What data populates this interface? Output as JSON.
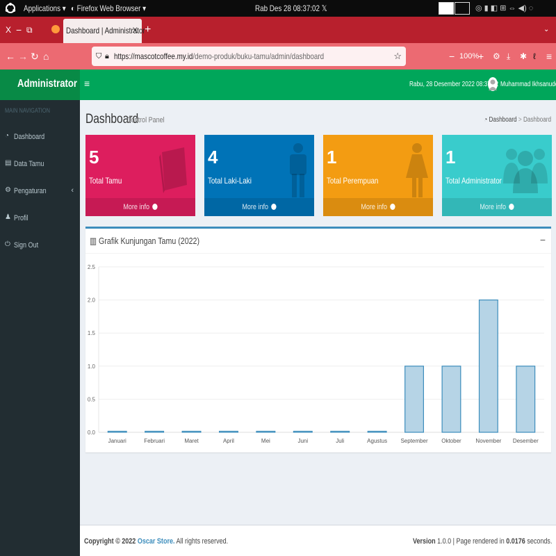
{
  "os_bar": {
    "applications": "Applications",
    "browser_name": "Firefox Web Browser",
    "clock": "Rab Des 28  08:37:02",
    "x_label": "𝕏"
  },
  "tabs": {
    "active_title": "Dashboard | Administrator",
    "close": "X",
    "new_tab": "+",
    "window_x": "X",
    "window_min": "−",
    "window_restore": "⧉"
  },
  "navbar": {
    "url_host": "https://mascotcoffee.my.id",
    "url_path": "/demo-produk/buku-tamu/admin/dashboard",
    "zoom": "100%",
    "zoom_minus": "−",
    "zoom_plus": "+"
  },
  "header": {
    "logo": "Administrator",
    "toggle": "≡",
    "datetime": "Rabu, 28 Desember 2022 08:37:02",
    "user_name": "Muhammad Ikhsanuddin"
  },
  "sidebar": {
    "heading": "MAIN NAVIGATION",
    "items": [
      {
        "label": "Dashboard",
        "icon": "dashboard-icon"
      },
      {
        "label": "Data Tamu",
        "icon": "book-icon"
      },
      {
        "label": "Pengaturan",
        "icon": "cogs-icon"
      },
      {
        "label": "Profil",
        "icon": "user-icon"
      },
      {
        "label": "Sign Out",
        "icon": "sign-out-icon"
      }
    ]
  },
  "page": {
    "title": "Dashboard",
    "subtitle": "Control Panel",
    "breadcrumb_home": "Dashboard",
    "breadcrumb_sep": ">",
    "breadcrumb_current": "Dashboard"
  },
  "stats": [
    {
      "value": "5",
      "label": "Total Tamu",
      "more": "More info",
      "color": "#dd1e5e",
      "icon": "book-icon"
    },
    {
      "value": "4",
      "label": "Total Laki-Laki",
      "more": "More info",
      "color": "#0073b7",
      "icon": "male-icon"
    },
    {
      "value": "1",
      "label": "Total Perempuan",
      "more": "More info",
      "color": "#f39c12",
      "icon": "female-icon"
    },
    {
      "value": "1",
      "label": "Total Administrator",
      "more": "More info",
      "color": "#39cccc",
      "icon": "users-icon"
    }
  ],
  "chart_panel": {
    "title": "Grafik Kunjungan Tamu (2022)",
    "minimize": "−"
  },
  "chart_data": {
    "type": "bar",
    "title": "Grafik Kunjungan Tamu (2022)",
    "categories": [
      "Januari",
      "Februari",
      "Maret",
      "April",
      "Mei",
      "Juni",
      "Juli",
      "Agustus",
      "September",
      "Oktober",
      "November",
      "Desember"
    ],
    "values": [
      0,
      0,
      0,
      0,
      0,
      0,
      0,
      0,
      1,
      1,
      2,
      1
    ],
    "ylim": [
      0,
      2.5
    ],
    "yticks": [
      "0.0",
      "0.5",
      "1.0",
      "1.5",
      "2.0",
      "2.5"
    ],
    "bar_fill": "#b6d4e6",
    "bar_stroke": "#3c8dbc",
    "grid": true
  },
  "footer": {
    "copyright": "Copyright © 2022",
    "brand": "Oscar Store.",
    "rights": " All rights reserved.",
    "version_label": "Version",
    "version": " 1.0.0 | Page rendered in ",
    "render_time": "0.0176",
    "seconds": " seconds."
  }
}
